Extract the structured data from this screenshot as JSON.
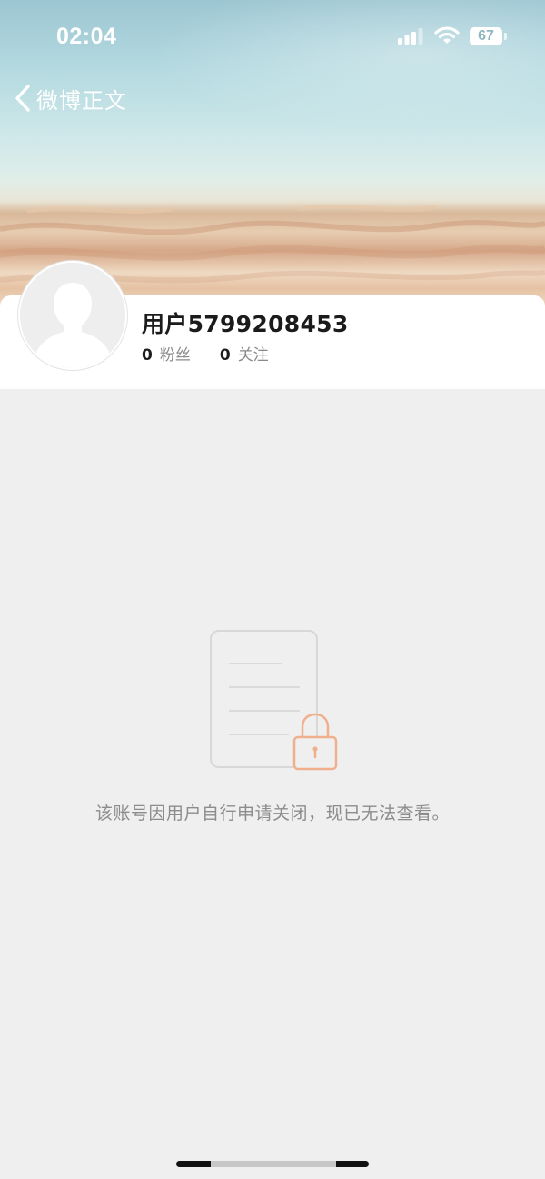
{
  "status_bar": {
    "time": "02:04",
    "battery": "67",
    "icons": [
      "signal-icon",
      "wifi-icon",
      "battery-icon"
    ]
  },
  "nav": {
    "back_label": "微博正文",
    "back_icon": "chevron-left-icon"
  },
  "profile": {
    "name": "用户5799208453",
    "followers_count": "0",
    "followers_label": "粉丝",
    "following_count": "0",
    "following_label": "关注",
    "avatar_icon": "default-avatar-icon"
  },
  "empty_state": {
    "icon": "locked-document-icon",
    "message": "该账号因用户自行申请关闭，现已无法查看。"
  },
  "colors": {
    "background": "#efefef",
    "lock_accent": "#f0b08e",
    "muted_text": "#8c8c8c"
  }
}
